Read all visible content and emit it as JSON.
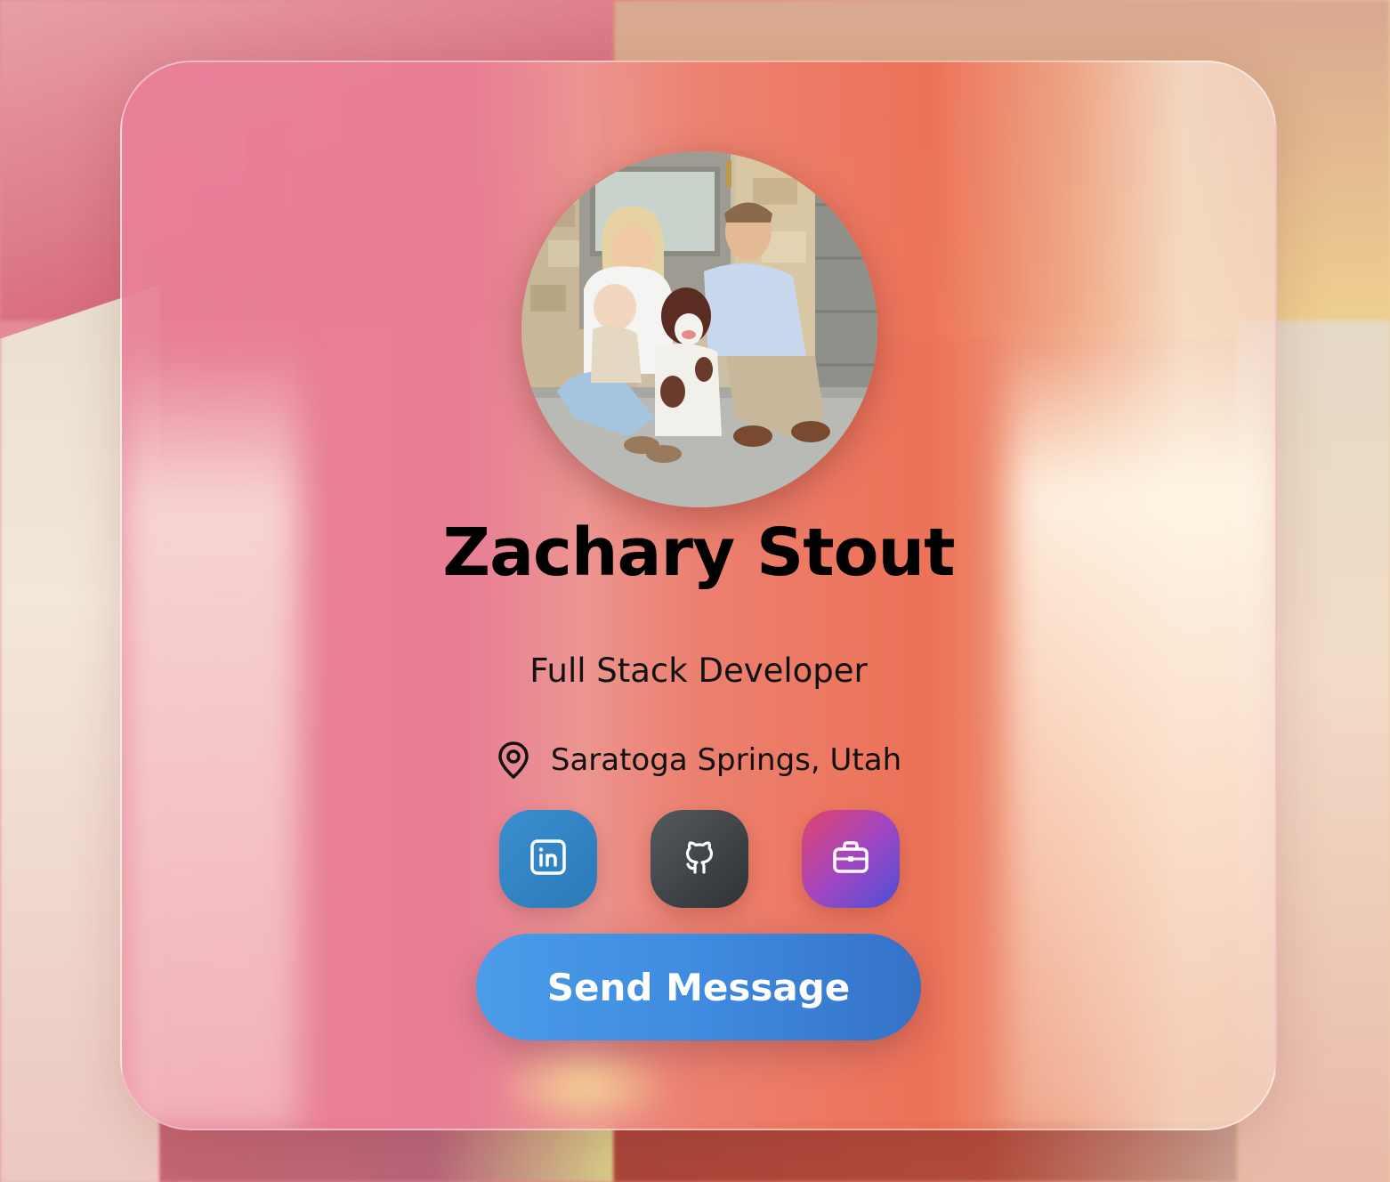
{
  "profile": {
    "name": "Zachary Stout",
    "role": "Full Stack Developer",
    "location": "Saratoga Springs, Utah"
  },
  "socials": [
    {
      "name": "LinkedIn",
      "icon": "linkedin-icon",
      "color": "#3a8fcf"
    },
    {
      "name": "GitHub",
      "icon": "github-icon",
      "color": "#3f4347"
    },
    {
      "name": "Portfolio",
      "icon": "briefcase-icon",
      "color": "#a446c0"
    }
  ],
  "actions": {
    "send_message_label": "Send Message"
  },
  "colors": {
    "button_blue": "#3f8be0",
    "text": "#000000"
  }
}
